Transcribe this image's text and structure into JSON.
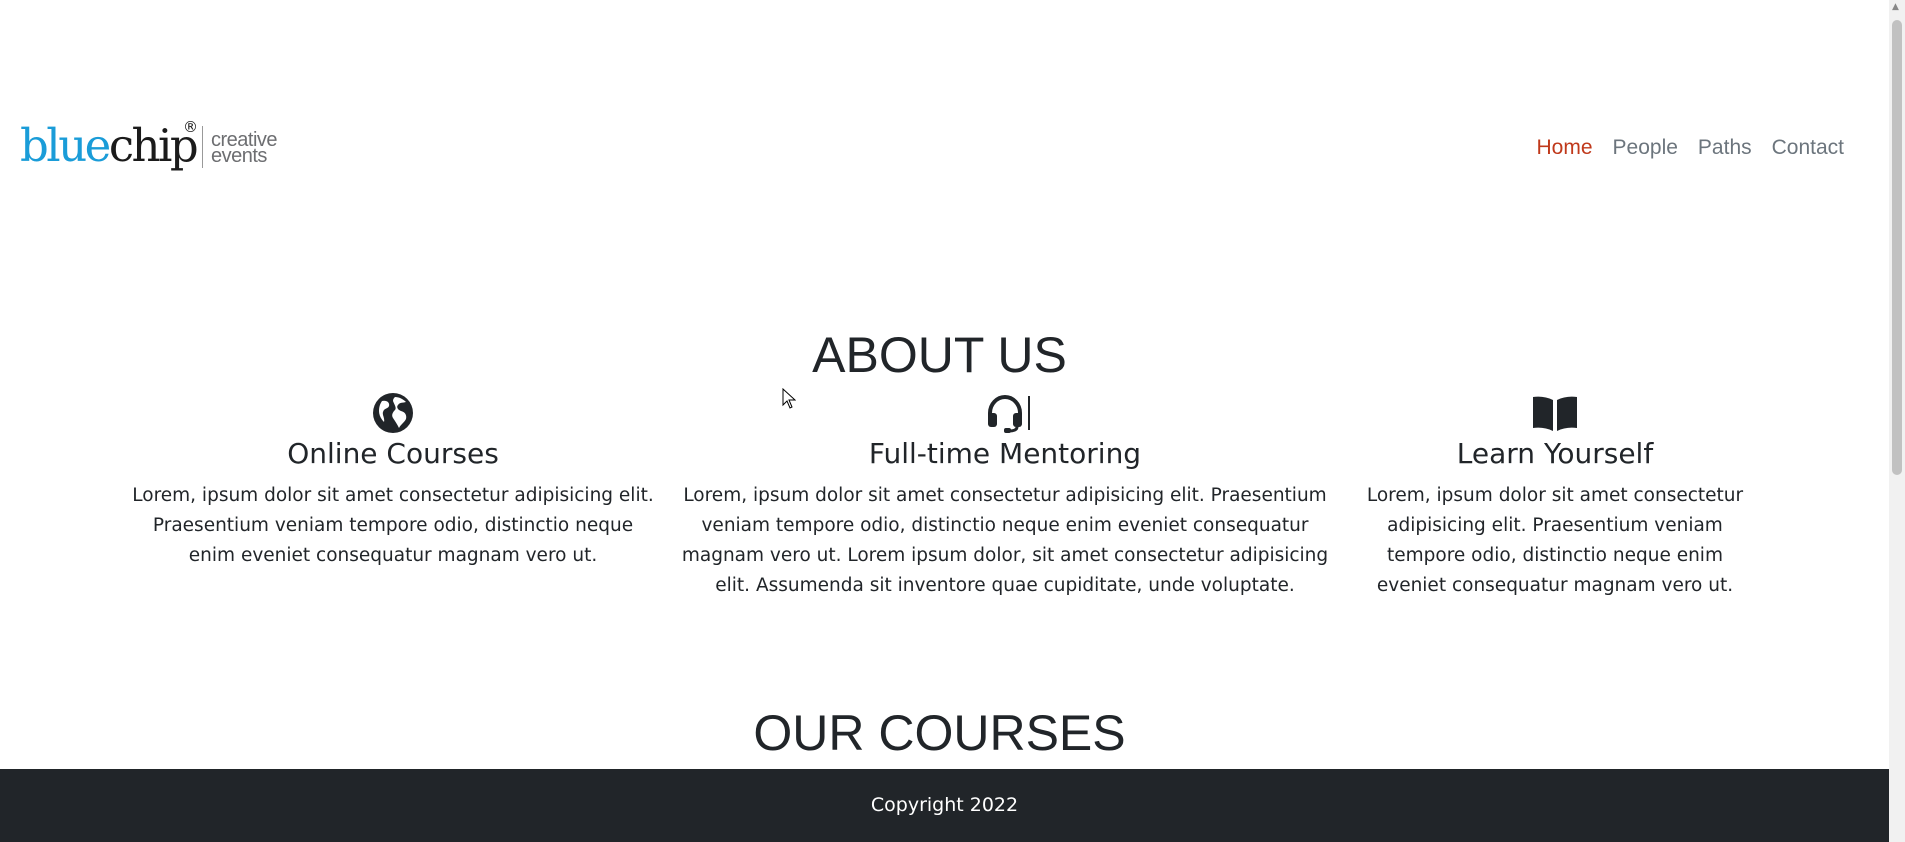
{
  "logo": {
    "part1": "blue",
    "part2": "chip",
    "reg": "®",
    "tag_line1": "creative",
    "tag_line2": "events"
  },
  "nav": {
    "items": [
      {
        "label": "Home",
        "active": true
      },
      {
        "label": "People"
      },
      {
        "label": "Paths"
      },
      {
        "label": "Contact"
      }
    ]
  },
  "about": {
    "title": "ABOUT US",
    "features": [
      {
        "icon": "globe-icon",
        "title": "Online Courses",
        "text": "Lorem, ipsum dolor sit amet consectetur adipisicing elit. Praesentium veniam tempore odio, distinctio neque enim eveniet consequatur magnam vero ut."
      },
      {
        "icon": "headset-icon",
        "title": "Full-time Mentoring",
        "text": "Lorem, ipsum dolor sit amet consectetur adipisicing elit. Praesentium veniam tempore odio, distinctio neque enim eveniet consequatur magnam vero ut. Lorem ipsum dolor, sit amet consectetur adipisicing elit. Assumenda sit inventore quae cupiditate, unde voluptate."
      },
      {
        "icon": "book-icon",
        "title": "Learn Yourself",
        "text": "Lorem, ipsum dolor sit amet consectetur adipisicing elit. Praesentium veniam tempore odio, distinctio neque enim eveniet consequatur magnam vero ut."
      }
    ]
  },
  "courses": {
    "title": "OUR COURSES"
  },
  "footer": {
    "text": "Copyright 2022"
  },
  "colors": {
    "brand_blue": "#1a9cd8",
    "nav_active": "#c0391b",
    "nav_default": "#6c757d",
    "footer_bg": "#212529"
  }
}
